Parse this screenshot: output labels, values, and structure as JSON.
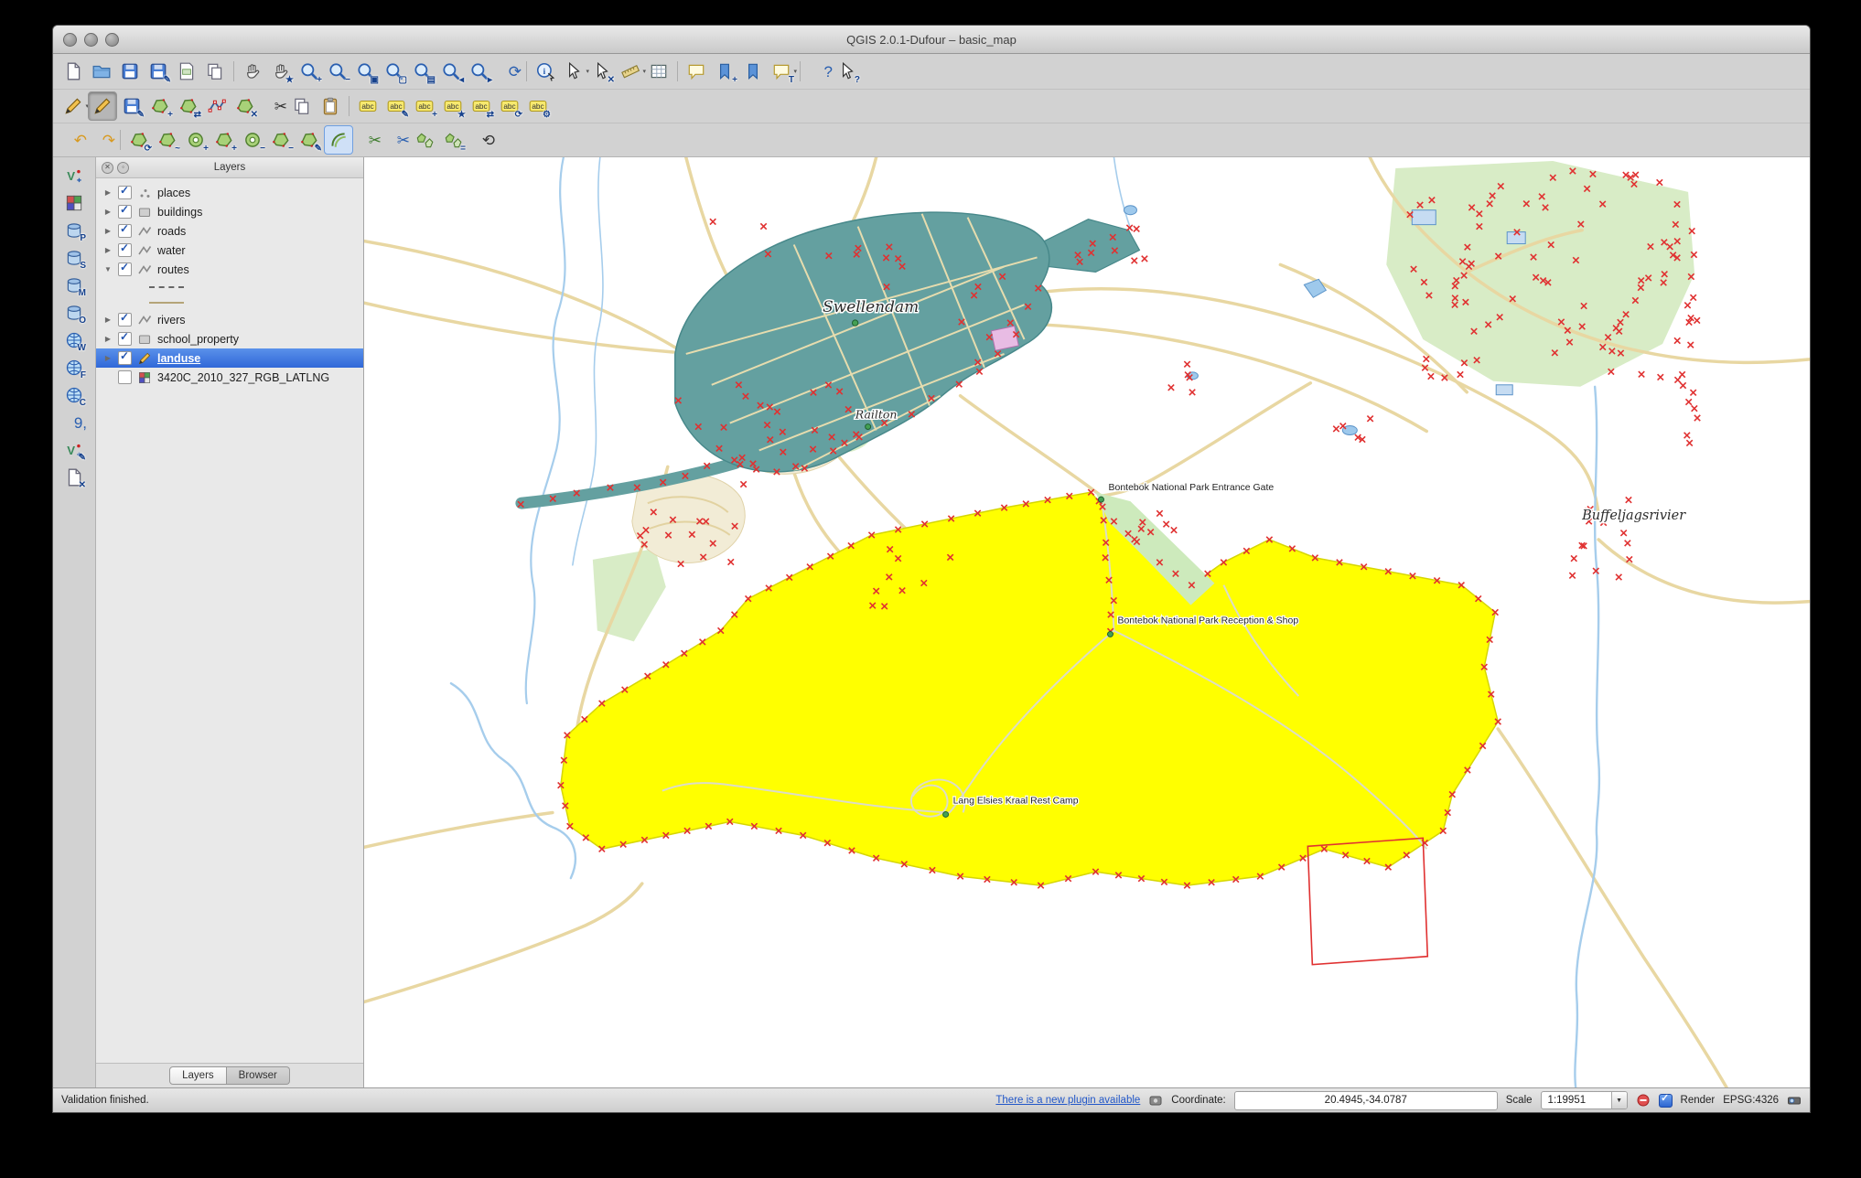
{
  "window": {
    "title": "QGIS 2.0.1-Dufour – basic_map"
  },
  "toolbars": {
    "main": [
      {
        "name": "new-project-icon",
        "href": "#sym-page"
      },
      {
        "name": "open-project-icon",
        "href": "#sym-folder"
      },
      {
        "name": "save-project-icon",
        "href": "#sym-floppy"
      },
      {
        "name": "save-project-as-icon",
        "href": "#sym-floppy",
        "ov": "✎"
      },
      {
        "name": "new-print-composer-icon",
        "href": "#sym-composer"
      },
      {
        "name": "composer-manager-icon",
        "href": "#sym-copy"
      },
      {
        "name": "toolbar-separator",
        "cls": "tb-btn tb-sep",
        "inter": "false"
      },
      {
        "name": "pan-map-icon",
        "href": "#sym-hand"
      },
      {
        "name": "pan-to-selection-icon",
        "href": "#sym-hand",
        "ov": "★"
      },
      {
        "name": "zoom-in-icon",
        "href": "#sym-magnifier",
        "ov": "+"
      },
      {
        "name": "zoom-out-icon",
        "href": "#sym-magnifier",
        "ov": "−"
      },
      {
        "name": "zoom-full-extent-icon",
        "href": "#sym-magnifier",
        "ov": "▣"
      },
      {
        "name": "zoom-to-selection-icon",
        "href": "#sym-magnifier",
        "ov": "▢"
      },
      {
        "name": "zoom-to-layer-icon",
        "href": "#sym-magnifier",
        "ov": "▤"
      },
      {
        "name": "zoom-last-icon",
        "href": "#sym-magnifier",
        "ov": "◂"
      },
      {
        "name": "zoom-next-icon",
        "href": "#sym-magnifier",
        "ov": "▸"
      },
      {
        "name": "refresh-map-icon",
        "glyph": "⟳",
        "cls": "tb-btn c-blue"
      },
      {
        "name": "toolbar-separator",
        "cls": "tb-btn tb-sep",
        "inter": "false"
      },
      {
        "name": "identify-features-icon",
        "href": "#sym-identify"
      },
      {
        "name": "select-features-icon",
        "href": "#sym-cursor",
        "dd": "▾"
      },
      {
        "name": "deselect-features-icon",
        "href": "#sym-cursor",
        "ov": "✕"
      },
      {
        "name": "measure-icon",
        "href": "#sym-ruler",
        "dd": "▾"
      },
      {
        "name": "open-attribute-table-icon",
        "href": "#sym-table"
      },
      {
        "name": "toolbar-separator",
        "cls": "tb-btn tb-sep",
        "inter": "false"
      },
      {
        "name": "map-tips-icon",
        "href": "#sym-bubble"
      },
      {
        "name": "new-bookmark-icon",
        "href": "#sym-bookmark",
        "ov": "+"
      },
      {
        "name": "show-bookmarks-icon",
        "href": "#sym-bookmark"
      },
      {
        "name": "text-annotation-icon",
        "href": "#sym-bubble",
        "ov": "T",
        "dd": "▾"
      },
      {
        "name": "toolbar-separator",
        "cls": "tb-btn tb-sep",
        "inter": "false"
      },
      {
        "name": "help-contents-icon",
        "glyph": "?",
        "cls": "tb-btn c-blue"
      },
      {
        "name": "whats-this-icon",
        "href": "#sym-cursor",
        "ov": "?"
      }
    ],
    "digitizing": [
      {
        "name": "current-edits-icon",
        "href": "#sym-pencil",
        "dd": "▾"
      },
      {
        "name": "toggle-editing-icon",
        "href": "#sym-pencil",
        "cls": "tb-btn active"
      },
      {
        "name": "save-layer-edits-icon",
        "href": "#sym-floppy",
        "ov": "✎"
      },
      {
        "name": "add-feature-icon",
        "href": "#sym-blob",
        "ov": "+"
      },
      {
        "name": "move-feature-icon",
        "href": "#sym-blob",
        "ov": "⇄"
      },
      {
        "name": "node-tool-icon",
        "href": "#sym-nodes"
      },
      {
        "name": "delete-selected-icon",
        "href": "#sym-blob",
        "ov": "✕"
      },
      {
        "name": "cut-features-icon",
        "glyph": "✂",
        "cls": "tb-btn c-dark"
      },
      {
        "name": "copy-features-icon",
        "href": "#sym-copy"
      },
      {
        "name": "paste-features-icon",
        "href": "#sym-paste"
      },
      {
        "name": "toolbar-separator",
        "cls": "tb-btn tb-sep",
        "inter": "false"
      },
      {
        "name": "labeling-icon",
        "href": "#sym-abc"
      },
      {
        "name": "label-settings-icon",
        "href": "#sym-abc",
        "ov": "✎"
      },
      {
        "name": "pin-labels-icon",
        "href": "#sym-abc",
        "ov": "+"
      },
      {
        "name": "highlight-labels-icon",
        "href": "#sym-abc",
        "ov": "★"
      },
      {
        "name": "move-label-icon",
        "href": "#sym-abc",
        "ov": "⇄"
      },
      {
        "name": "rotate-label-icon",
        "href": "#sym-abc",
        "ov": "⟳"
      },
      {
        "name": "change-label-icon",
        "href": "#sym-abc",
        "ov": "⚙"
      }
    ],
    "advanced": [
      {
        "name": "undo-icon",
        "glyph": "↶",
        "cls": "tb-btn c-orange"
      },
      {
        "name": "redo-icon",
        "glyph": "↷",
        "cls": "tb-btn c-orange"
      },
      {
        "name": "toolbar-separator",
        "cls": "tb-btn tb-sep",
        "inter": "false"
      },
      {
        "name": "rotate-feature-icon",
        "href": "#sym-blob",
        "ov": "⟳"
      },
      {
        "name": "simplify-feature-icon",
        "href": "#sym-blob",
        "ov": "~"
      },
      {
        "name": "add-ring-icon",
        "href": "#sym-donut",
        "ov": "+"
      },
      {
        "name": "add-part-icon",
        "href": "#sym-blob",
        "ov": "+"
      },
      {
        "name": "delete-ring-icon",
        "href": "#sym-donut",
        "ov": "−"
      },
      {
        "name": "delete-part-icon",
        "href": "#sym-blob",
        "ov": "−"
      },
      {
        "name": "reshape-features-icon",
        "href": "#sym-blob",
        "ov": "✎"
      },
      {
        "name": "offset-curve-icon",
        "href": "#sym-offset",
        "cls": "tb-btn selected"
      },
      {
        "name": "split-features-icon",
        "glyph": "✂",
        "cls": "tb-btn c-green"
      },
      {
        "name": "split-parts-icon",
        "glyph": "✂",
        "cls": "tb-btn c-blue"
      },
      {
        "name": "merge-features-icon",
        "href": "#sym-merge"
      },
      {
        "name": "merge-attributes-icon",
        "href": "#sym-merge",
        "ov": "="
      },
      {
        "name": "rotate-point-symbols-icon",
        "glyph": "⟲",
        "cls": "tb-btn c-dark"
      }
    ],
    "side": [
      {
        "name": "add-vector-layer-icon",
        "href": "#sym-layerv"
      },
      {
        "name": "add-raster-layer-icon",
        "href": "#sym-raster"
      },
      {
        "name": "add-postgis-layer-icon",
        "href": "#sym-db",
        "ov": "P"
      },
      {
        "name": "add-spatialite-layer-icon",
        "href": "#sym-db",
        "ov": "S"
      },
      {
        "name": "add-mssql-layer-icon",
        "href": "#sym-db",
        "ov": "M"
      },
      {
        "name": "add-oracle-layer-icon",
        "href": "#sym-db",
        "ov": "O"
      },
      {
        "name": "add-wms-layer-icon",
        "href": "#sym-globe",
        "ov": "W"
      },
      {
        "name": "add-wfs-layer-icon",
        "href": "#sym-globe",
        "ov": "F"
      },
      {
        "name": "add-wcs-layer-icon",
        "href": "#sym-globe",
        "ov": "C"
      },
      {
        "name": "add-delimited-text-icon",
        "glyph": "9,",
        "cls": "tb-btn c-blue"
      },
      {
        "name": "new-shapefile-layer-icon",
        "href": "#sym-layerv",
        "ov": "✎"
      },
      {
        "name": "remove-layer-icon",
        "href": "#sym-page",
        "ov": "✕"
      }
    ]
  },
  "layers_panel": {
    "title": "Layers",
    "items": [
      {
        "label": "places"
      },
      {
        "label": "buildings"
      },
      {
        "label": "roads"
      },
      {
        "label": "water"
      },
      {
        "label": "routes"
      },
      {
        "label": "rivers"
      },
      {
        "label": "school_property"
      },
      {
        "label": "landuse"
      },
      {
        "label": "3420C_2010_327_RGB_LATLNG"
      }
    ],
    "tabs": [
      {
        "label": "Layers"
      },
      {
        "label": "Browser"
      }
    ]
  },
  "map": {
    "labels": {
      "town": "Swellendam",
      "suburb": "Railton",
      "gate": "Bontebok National Park Entrance Gate",
      "reception": "Bontebok National Park Reception & Shop",
      "camp": "Lang Elsies Kraal Rest Camp",
      "river": "Buffeljagsrivier"
    },
    "colors": {
      "landuse": "#ffff00",
      "urban": "#64a0a0",
      "park": "#d8ecc6",
      "vertex": "#e03131",
      "water": "#a6cdec",
      "road": "#e8d7a2"
    }
  },
  "statusbar": {
    "left_text": "Validation finished.",
    "plugin_link": "There is a new plugin available",
    "coordinate_label": "Coordinate:",
    "coordinate_value": "20.4945,-34.0787",
    "scale_label": "Scale",
    "scale_value": "1:19951",
    "render_label": "Render",
    "crs_text": "EPSG:4326"
  }
}
